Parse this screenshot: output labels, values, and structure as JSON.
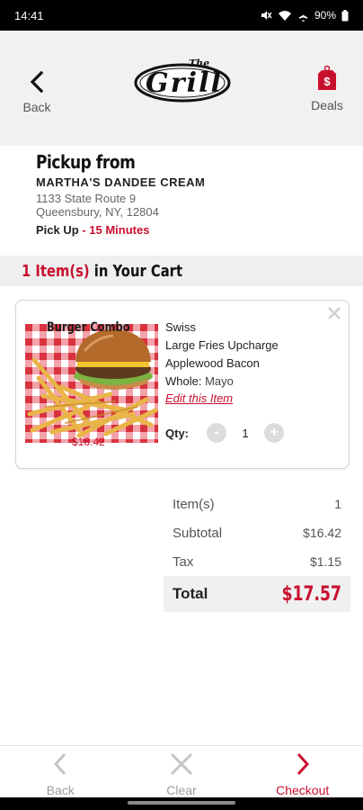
{
  "status_bar": {
    "time": "14:41",
    "battery": "90%"
  },
  "header": {
    "back_label": "Back",
    "deals_label": "Deals",
    "logo_text": "The Grill",
    "deals_tag": "$"
  },
  "pickup": {
    "title": "Pickup from",
    "store_name": "MARTHA'S DANDEE CREAM",
    "address_line1": "1133 State Route 9",
    "address_line2": "Queensbury, NY, 12804",
    "label": "Pick Up",
    "separator": " - ",
    "time": "15 Minutes"
  },
  "cart": {
    "count_text": "1 Item(s)",
    "suffix_text": " in Your Cart",
    "items": [
      {
        "image_title": "Burger Combo",
        "image_price": "$16.42",
        "modifiers": [
          "Swiss",
          "Large Fries Upcharge",
          "Applewood Bacon"
        ],
        "mod_whole_label": "Whole:",
        "mod_whole_value": "Mayo",
        "edit_label": "Edit this Item",
        "qty_label": "Qty:",
        "qty_value": "1",
        "qty_minus": "-",
        "qty_plus": "+"
      }
    ]
  },
  "totals": {
    "items_label": "Item(s)",
    "items_value": "1",
    "subtotal_label": "Subtotal",
    "subtotal_value": "$16.42",
    "tax_label": "Tax",
    "tax_value": "$1.15",
    "total_label": "Total",
    "total_value": "$17.57"
  },
  "bottom_nav": {
    "back_label": "Back",
    "clear_label": "Clear",
    "checkout_label": "Checkout"
  },
  "colors": {
    "accent": "#c8102e",
    "header_bg": "#f1f1f1"
  }
}
